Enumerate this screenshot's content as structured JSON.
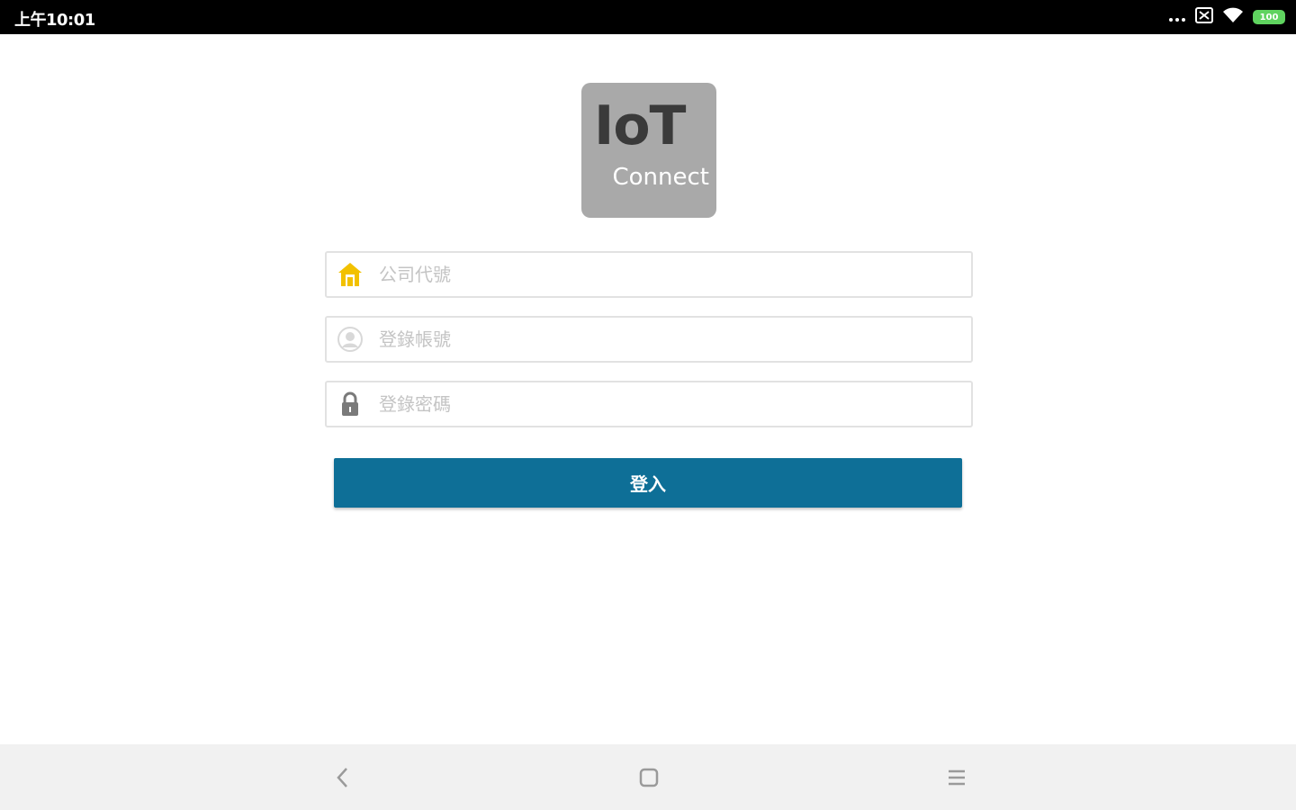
{
  "status_bar": {
    "time": "上午10:01",
    "icons": [
      "more-dots-icon",
      "sim-icon",
      "wifi-icon",
      "battery-icon"
    ],
    "battery_level": "100",
    "battery_color": "#5fd35f"
  },
  "logo": {
    "title": "IoT",
    "subtitle": "Connect",
    "background": "#a9a9a9"
  },
  "form": {
    "company_code": {
      "placeholder": "公司代號",
      "value": "",
      "icon": "house-icon",
      "icon_color": "#f2c100"
    },
    "account": {
      "placeholder": "登錄帳號",
      "value": "",
      "icon": "user-icon"
    },
    "password": {
      "placeholder": "登錄密碼",
      "value": "",
      "icon": "lock-icon"
    },
    "login_label": "登入",
    "login_color": "#0e6f97"
  },
  "nav_bar": {
    "buttons": [
      "back-icon",
      "home-icon",
      "menu-icon"
    ]
  }
}
